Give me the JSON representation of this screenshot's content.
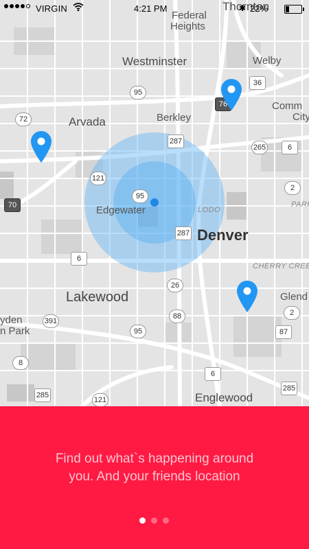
{
  "status_bar": {
    "carrier": "VIRGIN",
    "time": "4:21 PM",
    "battery_text": "22%",
    "battery_level": 0.22
  },
  "map": {
    "places": [
      {
        "name": "Thornton",
        "style": "city-med"
      },
      {
        "name": "Federal",
        "style": "city-sm"
      },
      {
        "name": "Heights",
        "style": "city-sm"
      },
      {
        "name": "Westminster",
        "style": "city-med"
      },
      {
        "name": "Welby",
        "style": "city-sm"
      },
      {
        "name": "Arvada",
        "style": "city-med"
      },
      {
        "name": "Berkley",
        "style": "city-sm"
      },
      {
        "name": "Comm",
        "style": "city-sm"
      },
      {
        "name": "City",
        "style": "city-sm"
      },
      {
        "name": "Edgewater",
        "style": "city-sm"
      },
      {
        "name": "Denver",
        "style": "denver"
      },
      {
        "name": "Lakewood",
        "style": "city-big"
      },
      {
        "name": "Glend",
        "style": "city-sm"
      },
      {
        "name": "yden",
        "style": "city-sm"
      },
      {
        "name": "n Park",
        "style": "city-sm"
      },
      {
        "name": "Englewood",
        "style": "city-med"
      },
      {
        "name": "LODO",
        "style": "area-label"
      },
      {
        "name": "PARK",
        "style": "area-label"
      },
      {
        "name": "CHERRY CREE",
        "style": "area-label"
      }
    ],
    "shields": [
      "95",
      "36",
      "76",
      "72",
      "287",
      "265",
      "6",
      "121",
      "2",
      "70",
      "95",
      "287",
      "6",
      "26",
      "391",
      "88",
      "2",
      "95",
      "87",
      "8",
      "6",
      "285",
      "121",
      "285"
    ]
  },
  "onboarding": {
    "tagline_line1": "Find out what`s happening around",
    "tagline_line2": "you. And  your friends location",
    "page_count": 3,
    "active_page": 0
  },
  "colors": {
    "panel": "#ff1a44",
    "pin": "#2196f3",
    "radius_fill": "#64b5f6"
  }
}
